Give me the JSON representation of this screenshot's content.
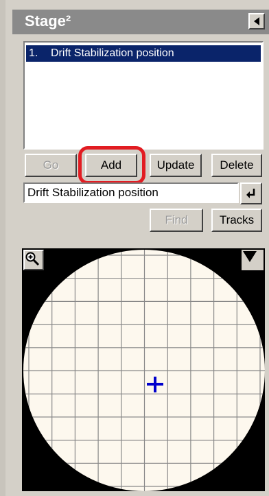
{
  "panel": {
    "title": "Stage²",
    "collapse_icon": "triangle-left-icon"
  },
  "positions_list": {
    "items": [
      {
        "number": "1.",
        "label": "Drift Stabilization position",
        "selected": true
      }
    ]
  },
  "buttons": {
    "go": "Go",
    "add": "Add",
    "update": "Update",
    "delete": "Delete",
    "find": "Find",
    "tracks": "Tracks"
  },
  "name_field": {
    "value": "Drift Stabilization position",
    "enter_icon": "enter-arrow-icon"
  },
  "stage_map": {
    "zoom_icon": "zoom-in-icon",
    "menu_icon": "triangle-down-icon",
    "marker_icon": "crosshair-icon",
    "colors": {
      "wafer": "#fdf8ee",
      "background": "#000000",
      "grid": "#888888",
      "marker": "#0000cc"
    }
  },
  "colors": {
    "selection": "#0a246a",
    "highlight": "#e21c22",
    "titlebar": "#8a8a8a"
  }
}
